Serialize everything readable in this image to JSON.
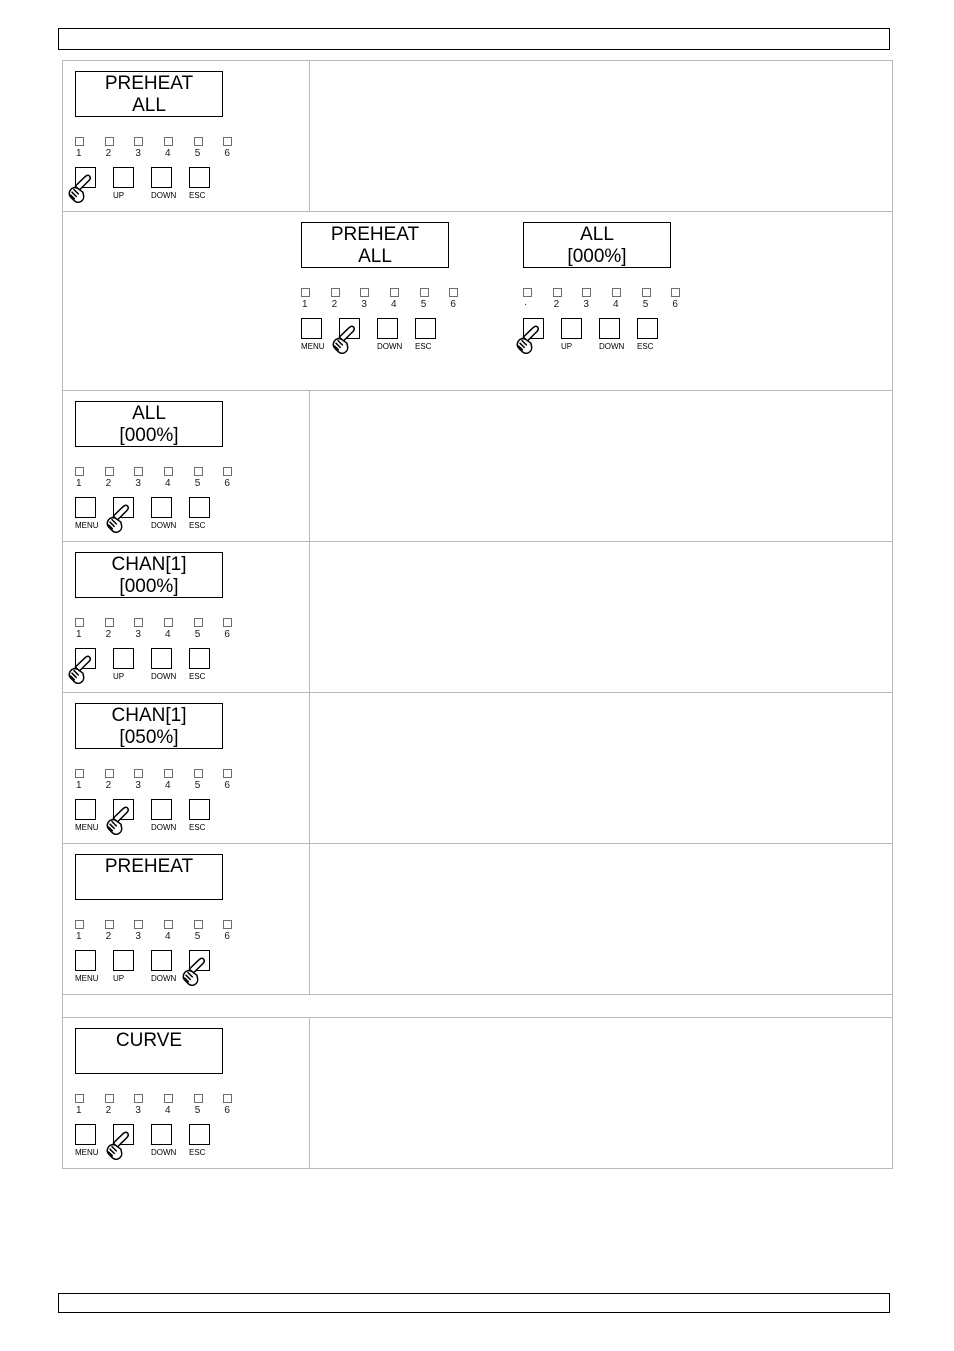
{
  "header": {
    "text": ""
  },
  "footer": {
    "text": ""
  },
  "common": {
    "led_labels": [
      "1",
      "2",
      "3",
      "4",
      "5",
      "6"
    ],
    "led_labels_alt": [
      "·",
      "2",
      "3",
      "4",
      "5",
      "6"
    ],
    "buttons_menu": [
      "MENU",
      "UP",
      "DOWN",
      "ESC"
    ],
    "hand_icon": "pointing-hand-icon",
    "lcd_blank": ""
  },
  "rows": [
    {
      "id": "row-1",
      "panel": {
        "lcd": {
          "line1": "PREHEAT",
          "line2": "ALL"
        },
        "leds": [
          "1",
          "2",
          "3",
          "4",
          "5",
          "6"
        ],
        "buttons": [
          {
            "label": "MENU",
            "pressed": true
          },
          {
            "label": "UP",
            "pressed": false
          },
          {
            "label": "DOWN",
            "pressed": false
          },
          {
            "label": "ESC",
            "pressed": false
          }
        ]
      },
      "note": ""
    },
    {
      "id": "row-2",
      "panel_a": {
        "lcd": {
          "line1": "PREHEAT",
          "line2": "ALL"
        },
        "leds": [
          "1",
          "2",
          "3",
          "4",
          "5",
          "6"
        ],
        "buttons": [
          {
            "label": "MENU",
            "pressed": false
          },
          {
            "label": "UP",
            "pressed": true
          },
          {
            "label": "DOWN",
            "pressed": false
          },
          {
            "label": "ESC",
            "pressed": false
          }
        ]
      },
      "panel_b": {
        "lcd": {
          "line1": "ALL",
          "line2": "[000%]"
        },
        "leds": [
          "·",
          "2",
          "3",
          "4",
          "5",
          "6"
        ],
        "buttons": [
          {
            "label": "MENU",
            "pressed": true
          },
          {
            "label": "UP",
            "pressed": false
          },
          {
            "label": "DOWN",
            "pressed": false
          },
          {
            "label": "ESC",
            "pressed": false
          }
        ]
      }
    },
    {
      "id": "row-3",
      "panel": {
        "lcd": {
          "line1": "ALL",
          "line2": "[000%]"
        },
        "leds": [
          "1",
          "2",
          "3",
          "4",
          "5",
          "6"
        ],
        "buttons": [
          {
            "label": "MENU",
            "pressed": false
          },
          {
            "label": "UP",
            "pressed": true
          },
          {
            "label": "DOWN",
            "pressed": false
          },
          {
            "label": "ESC",
            "pressed": false
          }
        ]
      },
      "note": ""
    },
    {
      "id": "row-4",
      "panel": {
        "lcd": {
          "line1": "CHAN[1]",
          "line2": "[000%]"
        },
        "leds": [
          "1",
          "2",
          "3",
          "4",
          "5",
          "6"
        ],
        "buttons": [
          {
            "label": "MENU",
            "pressed": true
          },
          {
            "label": "UP",
            "pressed": false
          },
          {
            "label": "DOWN",
            "pressed": false
          },
          {
            "label": "ESC",
            "pressed": false
          }
        ]
      },
      "note": ""
    },
    {
      "id": "row-5",
      "panel": {
        "lcd": {
          "line1": "CHAN[1]",
          "line2": "[050%]"
        },
        "leds": [
          "1",
          "2",
          "3",
          "4",
          "5",
          "6"
        ],
        "buttons": [
          {
            "label": "MENU",
            "pressed": false
          },
          {
            "label": "UP",
            "pressed": true
          },
          {
            "label": "DOWN",
            "pressed": false
          },
          {
            "label": "ESC",
            "pressed": false
          }
        ]
      },
      "note": ""
    },
    {
      "id": "row-6",
      "panel": {
        "lcd": {
          "line1": "PREHEAT",
          "line2": ""
        },
        "leds": [
          "1",
          "2",
          "3",
          "4",
          "5",
          "6"
        ],
        "buttons": [
          {
            "label": "MENU",
            "pressed": false
          },
          {
            "label": "UP",
            "pressed": false
          },
          {
            "label": "DOWN",
            "pressed": false
          },
          {
            "label": "ESC",
            "pressed": true
          }
        ]
      },
      "note": ""
    },
    {
      "id": "row-spacer",
      "note": ""
    },
    {
      "id": "row-7",
      "panel": {
        "lcd": {
          "line1": "CURVE",
          "line2": ""
        },
        "leds": [
          "1",
          "2",
          "3",
          "4",
          "5",
          "6"
        ],
        "buttons": [
          {
            "label": "MENU",
            "pressed": false
          },
          {
            "label": "UP",
            "pressed": true
          },
          {
            "label": "DOWN",
            "pressed": false
          },
          {
            "label": "ESC",
            "pressed": false
          }
        ]
      },
      "note": ""
    }
  ]
}
